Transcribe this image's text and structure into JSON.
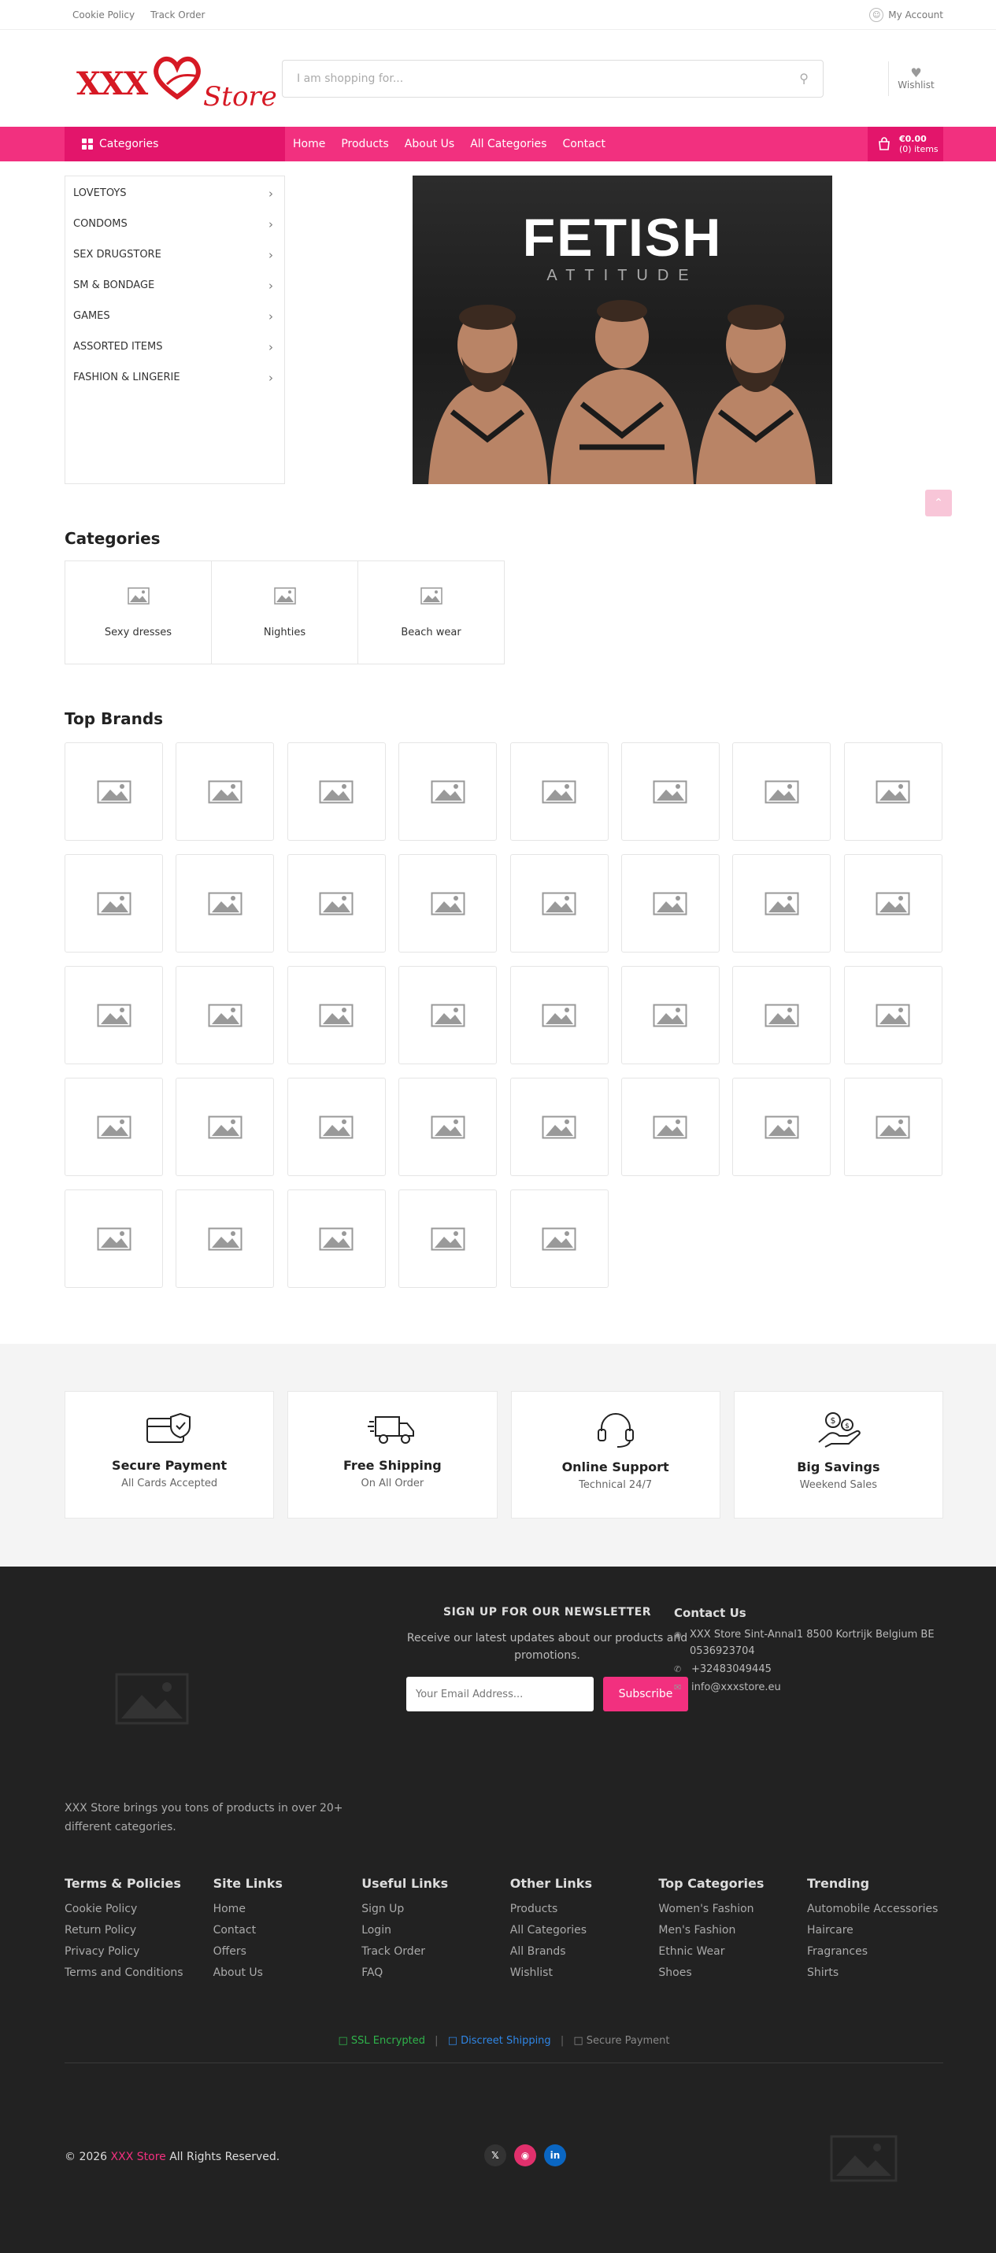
{
  "topbar": {
    "cookie_policy": "Cookie Policy",
    "track_order": "Track Order",
    "my_account": "My Account"
  },
  "header": {
    "logo_xxx": "XXX",
    "logo_store": "Store",
    "search_placeholder": "I am shopping for...",
    "wishlist": "Wishlist"
  },
  "nav": {
    "categories_label": "Categories",
    "links": [
      "Home",
      "Products",
      "About Us",
      "All Categories",
      "Contact"
    ],
    "cart_amount": "€0.00",
    "cart_items": "(0) items"
  },
  "sidebar": {
    "items": [
      "LOVETOYS",
      "CONDOMS",
      "SEX DRUGSTORE",
      "SM & BONDAGE",
      "GAMES",
      "ASSORTED ITEMS",
      "FASHION & LINGERIE"
    ]
  },
  "banner": {
    "title": "FETISH",
    "subtitle": "ATTITUDE"
  },
  "categories": {
    "heading": "Categories",
    "items": [
      "Sexy dresses",
      "Nighties",
      "Beach wear"
    ]
  },
  "brands": {
    "heading": "Top Brands",
    "count": 37
  },
  "features": [
    {
      "title": "Secure Payment",
      "subtitle": "All Cards Accepted",
      "icon": "card-shield-icon"
    },
    {
      "title": "Free Shipping",
      "subtitle": "On All Order",
      "icon": "delivery-truck-icon"
    },
    {
      "title": "Online Support",
      "subtitle": "Technical 24/7",
      "icon": "headset-icon"
    },
    {
      "title": "Big Savings",
      "subtitle": "Weekend Sales",
      "icon": "hand-money-icon"
    }
  ],
  "footer": {
    "description": "XXX Store brings you tons of products in over 20+ different categories.",
    "newsletter": {
      "heading": "SIGN UP FOR OUR NEWSLETTER",
      "text": "Receive our latest updates about our products and promotions.",
      "email_placeholder": "Your Email Address...",
      "button": "Subscribe"
    },
    "contact": {
      "heading": "Contact Us",
      "address": "XXX Store Sint-Annal1 8500 Kortrijk Belgium BE 0536923704",
      "phone": "+32483049445",
      "email": "info@xxxstore.eu"
    },
    "columns": [
      {
        "heading": "Terms & Policies",
        "links": [
          "Cookie Policy",
          "Return Policy",
          "Privacy Policy",
          "Terms and Conditions"
        ]
      },
      {
        "heading": "Site Links",
        "links": [
          "Home",
          "Contact",
          "Offers",
          "About Us"
        ]
      },
      {
        "heading": "Useful Links",
        "links": [
          "Sign Up",
          "Login",
          "Track Order",
          "FAQ"
        ]
      },
      {
        "heading": "Other Links",
        "links": [
          "Products",
          "All Categories",
          "All Brands",
          "Wishlist"
        ]
      },
      {
        "heading": "Top Categories",
        "links": [
          "Women's Fashion",
          "Men's Fashion",
          "Ethnic Wear",
          "Shoes"
        ]
      },
      {
        "heading": "Trending",
        "links": [
          "Automobile Accessories",
          "Haircare",
          "Fragrances",
          "Shirts"
        ]
      }
    ],
    "trust": {
      "ssl": " SSL Encrypted",
      "shipping": " Discreet Shipping",
      "payment": " Secure Payment"
    },
    "copyright_prefix": "© 2026 ",
    "copyright_brand": "XXX Store",
    "copyright_suffix": " All Rights Reserved.",
    "social": [
      "X",
      "Instagram",
      "LinkedIn"
    ]
  },
  "colors": {
    "brand_pink": "#f2307f",
    "brand_pink_dark": "#e3156b",
    "logo_red": "#d61924",
    "footer_bg": "#222222"
  }
}
